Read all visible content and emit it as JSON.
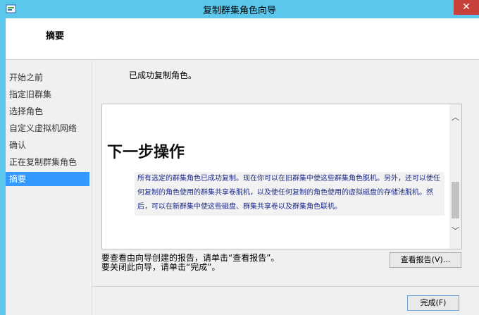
{
  "window": {
    "title": "复制群集角色向导",
    "close_glyph": "✕"
  },
  "header": {
    "title": "摘要"
  },
  "nav": {
    "items": [
      {
        "label": "开始之前",
        "active": false
      },
      {
        "label": "指定旧群集",
        "active": false
      },
      {
        "label": "选择角色",
        "active": false
      },
      {
        "label": "自定义虚拟机网络",
        "active": false
      },
      {
        "label": "确认",
        "active": false
      },
      {
        "label": "正在复制群集角色",
        "active": false
      },
      {
        "label": "摘要",
        "active": true
      }
    ]
  },
  "main": {
    "status": "已成功复制角色。",
    "report": {
      "heading": "下一步操作",
      "body": "所有选定的群集角色已成功复制。现在你可以在旧群集中使这些群集角色脱机。另外，还可以使任何复制的角色使用的群集共享卷脱机，以及使任何复制的角色使用的虚拟磁盘的存储池脱机。然后，可以在新群集中使这些磁盘、群集共享卷以及群集角色联机。"
    },
    "help_line1": "要查看由向导创建的报告，请单击“查看报告”。",
    "help_line2": "要关闭此向导，请单击“完成”。",
    "view_report_label": "查看报告(V)...",
    "finish_label": "完成(F)"
  },
  "colors": {
    "titlebar": "#5bc7ec",
    "close": "#c7413a",
    "nav_active": "#3399ff",
    "report_text": "#1a2a8c"
  },
  "icons": [
    "wizard-app-icon",
    "close-icon",
    "scroll-up-icon",
    "scroll-down-icon"
  ]
}
